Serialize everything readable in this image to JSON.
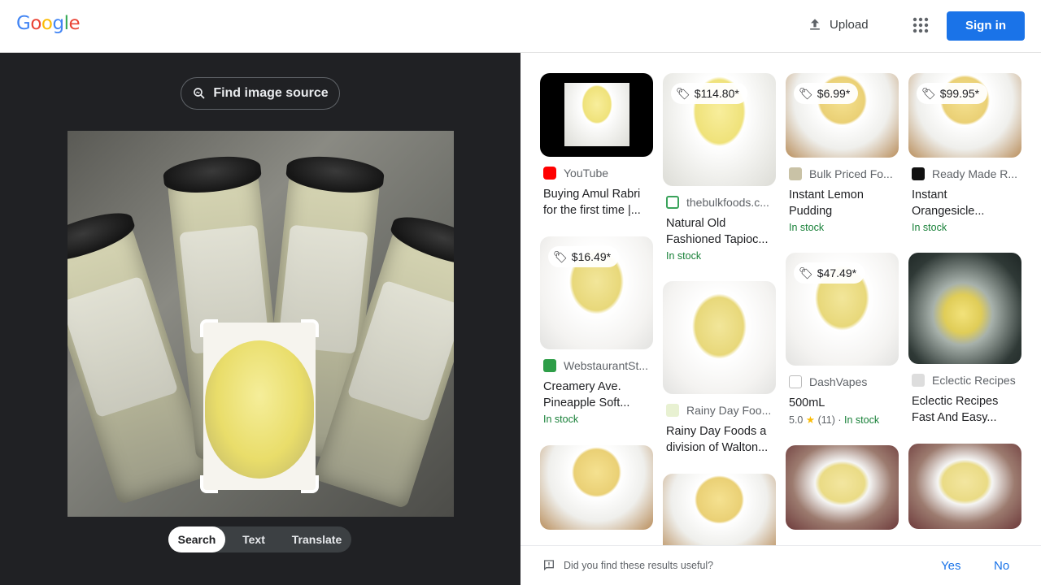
{
  "header": {
    "logo": "Google",
    "upload_label": "Upload",
    "signin_label": "Sign in"
  },
  "lens": {
    "find_source_label": "Find image source",
    "modes": [
      "Search",
      "Text",
      "Translate"
    ],
    "active_mode": "Search"
  },
  "results": [
    {
      "source": "YouTube",
      "title": "Buying Amul Rabri for the first time |...",
      "price": null,
      "stock": null,
      "rating": null
    },
    {
      "source": "thebulkfoods.c...",
      "title": "Natural Old Fashioned Tapioc...",
      "price": "$114.80*",
      "stock": "In stock",
      "rating": null
    },
    {
      "source": "Bulk Priced Fo...",
      "title": "Instant Lemon Pudding",
      "price": "$6.99*",
      "stock": "In stock",
      "rating": null
    },
    {
      "source": "Ready Made R...",
      "title": "Instant Orangesicle...",
      "price": "$99.95*",
      "stock": "In stock",
      "rating": null
    },
    {
      "source": "WebstaurantSt...",
      "title": "Creamery Ave. Pineapple Soft...",
      "price": "$16.49*",
      "stock": "In stock",
      "rating": null
    },
    {
      "source": "Rainy Day Foo...",
      "title": "Rainy Day Foods a division of Walton...",
      "price": null,
      "stock": null,
      "rating": null
    },
    {
      "source": "DashVapes",
      "title": "500mL",
      "price": "$47.49*",
      "stock": "In stock",
      "rating": {
        "score": "5.0",
        "count": "(11)"
      }
    },
    {
      "source": "Eclectic Recipes",
      "title": "Eclectic Recipes Fast And Easy...",
      "price": null,
      "stock": null,
      "rating": null
    }
  ],
  "feedback": {
    "question": "Did you find these results useful?",
    "yes": "Yes",
    "no": "No"
  },
  "colors": {
    "brand_blue": "#1a73e8",
    "dark_panel": "#202124",
    "in_stock_green": "#188038"
  }
}
